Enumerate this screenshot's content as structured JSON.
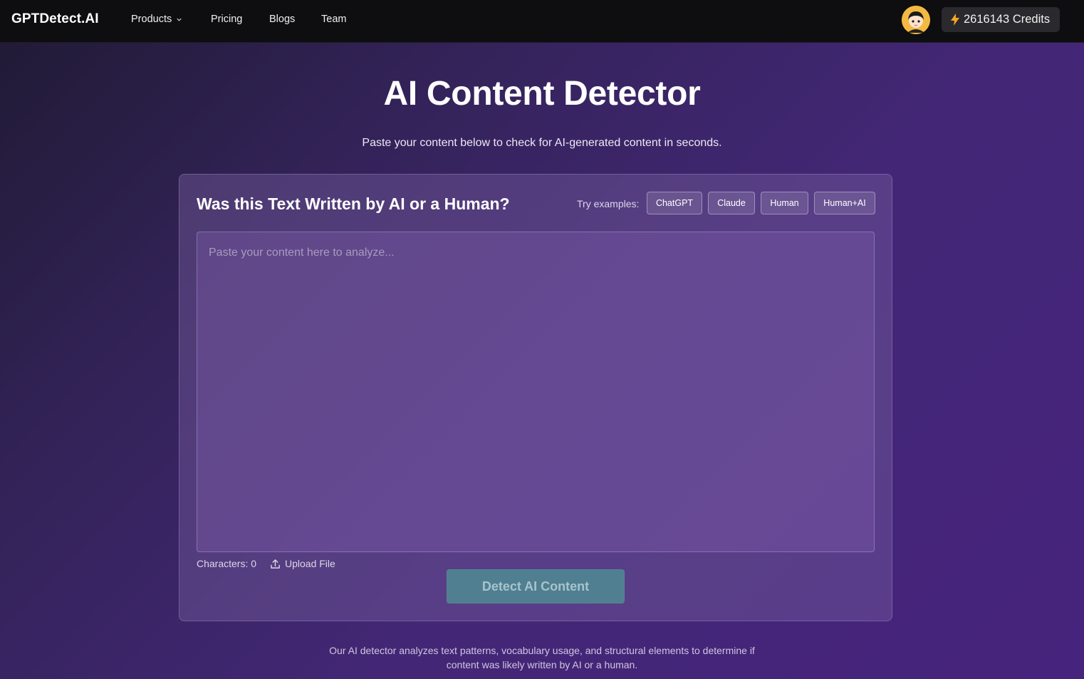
{
  "nav": {
    "logo": "GPTDetect.AI",
    "items": [
      {
        "label": "Products"
      },
      {
        "label": "Pricing"
      },
      {
        "label": "Blogs"
      },
      {
        "label": "Team"
      }
    ],
    "credits_label": "2616143 Credits"
  },
  "hero": {
    "title": "AI Content Detector",
    "subtitle": "Paste your content below to check for AI-generated content in seconds."
  },
  "card": {
    "title": "Was this Text Written by AI or a Human?",
    "try_label": "Try examples:",
    "examples": [
      "ChatGPT",
      "Claude",
      "Human",
      "Human+AI"
    ],
    "textarea_placeholder": "Paste your content here to analyze...",
    "textarea_value": "",
    "char_count": "Characters: 0",
    "upload_label": "Upload File",
    "detect_label": "Detect AI Content"
  },
  "footer": {
    "line1": "Our AI detector analyzes text patterns, vocabulary usage, and structural elements to determine if",
    "line2": "content was likely written by AI or a human."
  },
  "colors": {
    "accent_button": "#4f7f90",
    "credits_bolt": "#f5a623"
  }
}
